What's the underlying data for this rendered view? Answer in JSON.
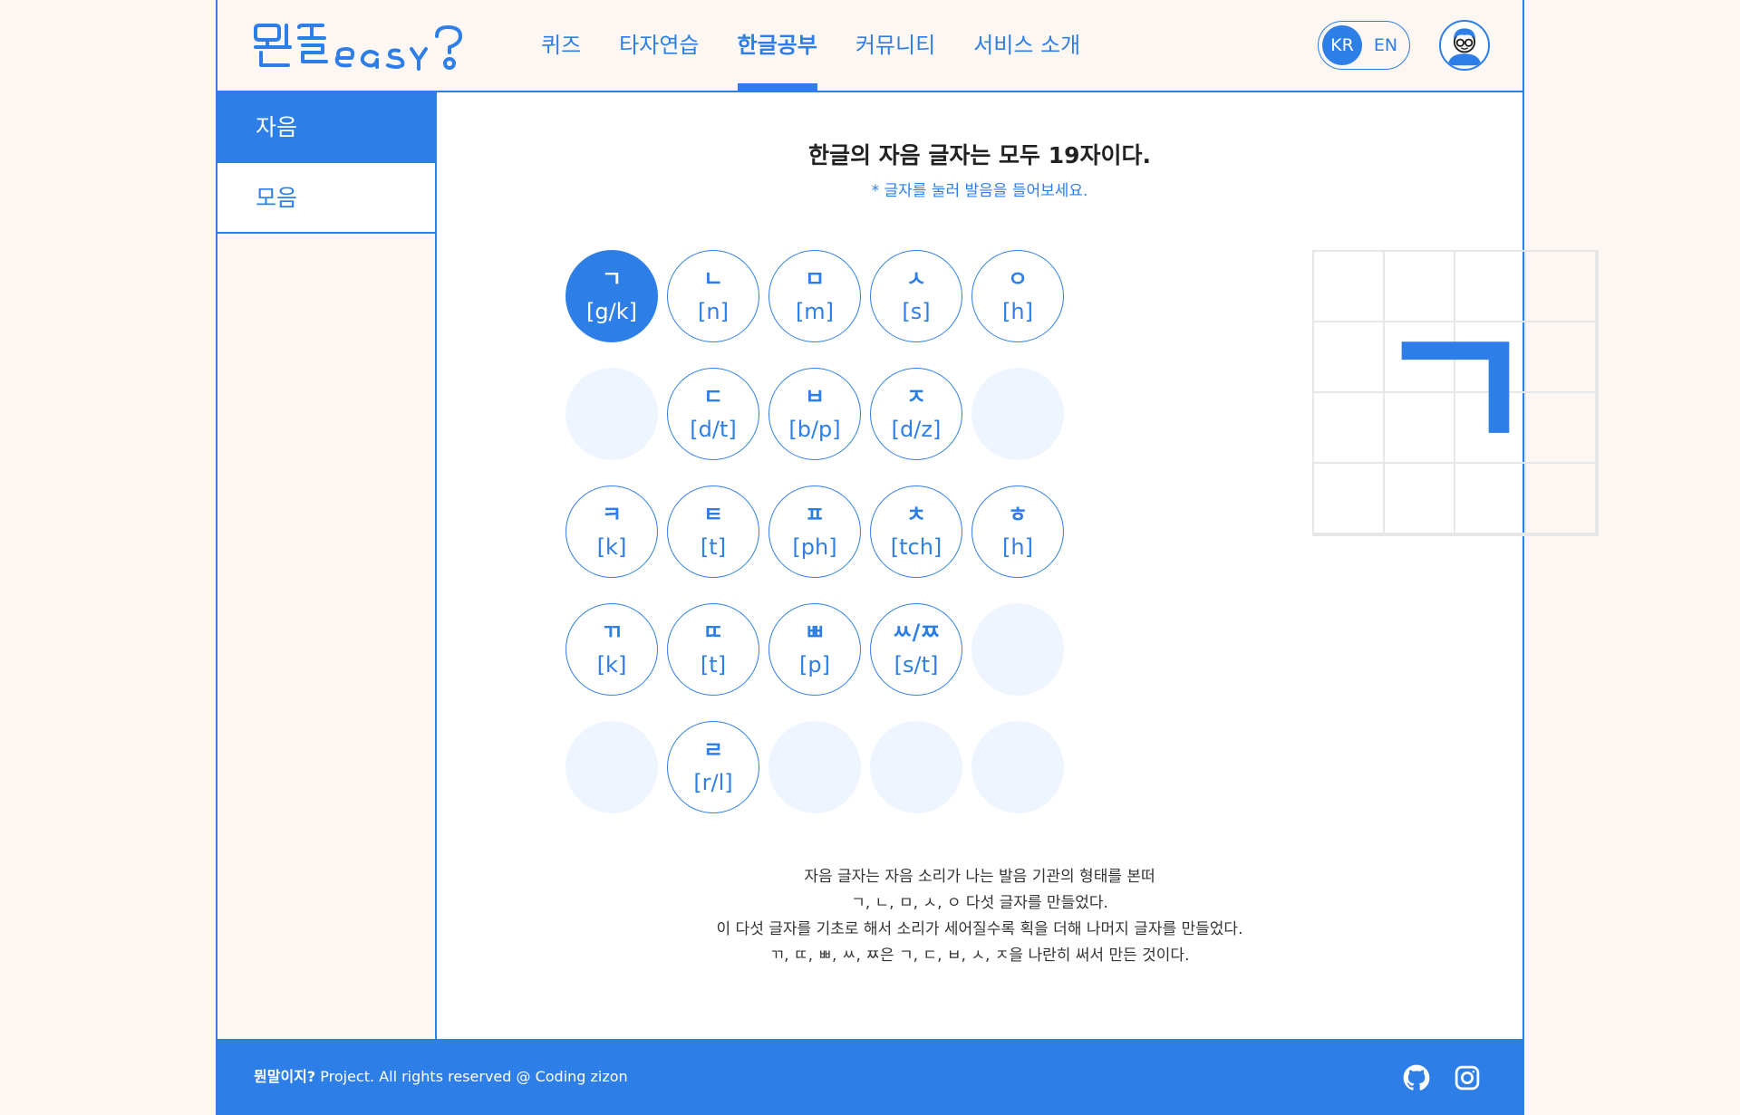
{
  "header": {
    "logo_alt": "뭔말easy?",
    "nav": [
      {
        "label": "퀴즈",
        "active": false
      },
      {
        "label": "타자연습",
        "active": false
      },
      {
        "label": "한글공부",
        "active": true
      },
      {
        "label": "커뮤니티",
        "active": false
      },
      {
        "label": "서비스 소개",
        "active": false
      }
    ],
    "lang": {
      "kr": "KR",
      "en": "EN",
      "selected": "KR"
    }
  },
  "sidebar": {
    "items": [
      {
        "label": "자음",
        "active": true
      },
      {
        "label": "모음",
        "active": false
      }
    ]
  },
  "main": {
    "title": "한글의 자음 글자는 모두 19자이다.",
    "hint": "* 글자를 눌러 발음을 들어보세요.",
    "consonants": [
      {
        "glyph": "ㄱ",
        "roman": "[g/k]",
        "selected": true
      },
      {
        "glyph": "ㄴ",
        "roman": "[n]"
      },
      {
        "glyph": "ㅁ",
        "roman": "[m]"
      },
      {
        "glyph": "ㅅ",
        "roman": "[s]"
      },
      {
        "glyph": "ㅇ",
        "roman": "[h]"
      },
      {
        "glyph": "ㄷ",
        "roman": "[d/t]"
      },
      {
        "glyph": "ㅂ",
        "roman": "[b/p]"
      },
      {
        "glyph": "ㅈ",
        "roman": "[d/z]"
      },
      {
        "glyph": "ㅋ",
        "roman": "[k]"
      },
      {
        "glyph": "ㅌ",
        "roman": "[t]"
      },
      {
        "glyph": "ㅍ",
        "roman": "[ph]"
      },
      {
        "glyph": "ㅊ",
        "roman": "[tch]"
      },
      {
        "glyph": "ㅎ",
        "roman": "[h]"
      },
      {
        "glyph": "ㄲ",
        "roman": "[k]"
      },
      {
        "glyph": "ㄸ",
        "roman": "[t]"
      },
      {
        "glyph": "ㅃ",
        "roman": "[p]"
      },
      {
        "glyph": "ㅆ/ㅉ",
        "roman": "[s/t]"
      },
      {
        "glyph": "ㄹ",
        "roman": "[r/l]"
      }
    ],
    "board_glyph": "ㄱ",
    "description": [
      "자음 글자는 자음 소리가 나는 발음 기관의 형태를 본떠",
      "ㄱ, ㄴ, ㅁ, ㅅ, ㅇ 다섯 글자를 만들었다.",
      "이 다섯 글자를 기초로 해서 소리가 세어질수록 획을 더해 나머지 글자를 만들었다.",
      "ㄲ, ㄸ, ㅃ, ㅆ, ㅉ은 ㄱ, ㄷ, ㅂ, ㅅ, ㅈ을 나란히 써서 만든 것이다."
    ]
  },
  "footer": {
    "brand": "뭔말이지?",
    "text": " Project. All rights reserved @ Coding zizon",
    "icons": [
      "github-icon",
      "instagram-icon"
    ]
  },
  "colors": {
    "accent": "#2d7fe7",
    "background": "#fcf7f2",
    "empty_cell": "#eef5ff"
  }
}
